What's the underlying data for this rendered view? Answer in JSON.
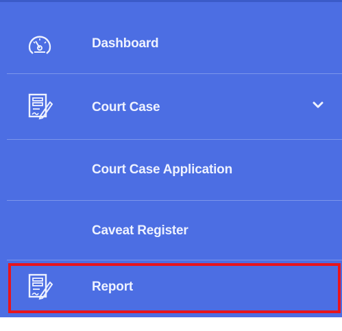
{
  "menu": {
    "items": [
      {
        "label": "Dashboard",
        "icon": "dashboard-gauge-icon"
      },
      {
        "label": "Court Case",
        "icon": "document-edit-icon",
        "expanded": true
      },
      {
        "label": "Court Case Application"
      },
      {
        "label": "Caveat Register"
      },
      {
        "label": "Report",
        "icon": "document-edit-icon",
        "highlighted": true
      }
    ]
  },
  "colors": {
    "sidebar_bg": "#4c6ee3",
    "text": "#eef2ff",
    "highlight_border": "#e8141c"
  }
}
